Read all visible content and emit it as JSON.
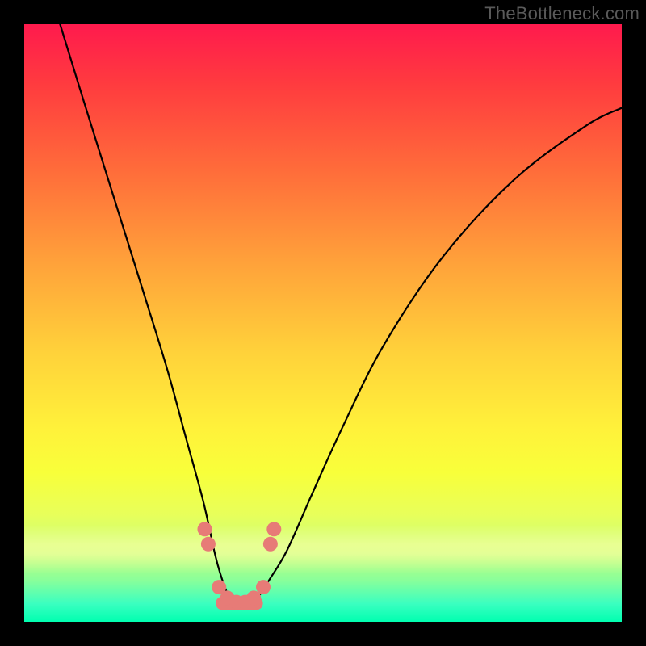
{
  "watermark": "TheBottleneck.com",
  "chart_data": {
    "type": "line",
    "title": "",
    "xlabel": "",
    "ylabel": "",
    "xlim": [
      0,
      100
    ],
    "ylim": [
      0,
      100
    ],
    "grid": false,
    "legend": false,
    "series": [
      {
        "name": "bottleneck-curve",
        "x": [
          6,
          10,
          15,
          20,
          24,
          27,
          30,
          32,
          33.5,
          35,
          37,
          39,
          41,
          44,
          48,
          53,
          60,
          70,
          82,
          94,
          100
        ],
        "values": [
          100,
          87,
          71,
          55,
          42,
          31,
          20,
          11,
          6,
          3,
          3,
          4,
          7,
          12,
          21,
          32,
          46,
          61,
          74,
          83,
          86
        ]
      }
    ],
    "markers": {
      "color": "#e77b77",
      "points_x": [
        30.2,
        30.8,
        32.6,
        34.0,
        35.5,
        37.0,
        38.4,
        40.0,
        41.2,
        41.8
      ],
      "points_y": [
        15.5,
        13.0,
        5.8,
        4.0,
        3.3,
        3.3,
        4.0,
        5.8,
        13.0,
        15.5
      ]
    },
    "background_gradient": {
      "top": "#ff1a4d",
      "mid1": "#ffa23a",
      "mid2": "#fff23a",
      "bottom": "#00ffb0"
    }
  }
}
